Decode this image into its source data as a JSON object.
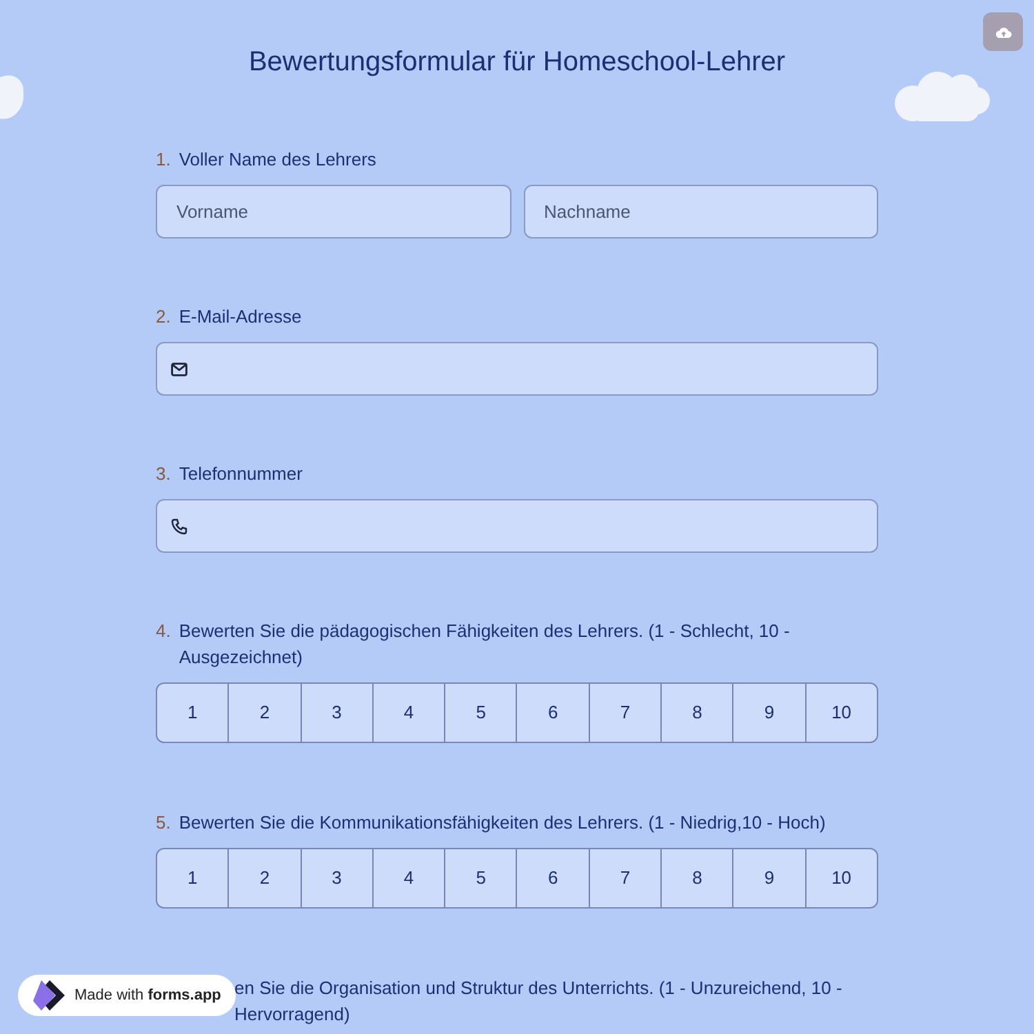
{
  "title": "Bewertungsformular für Homeschool-Lehrer",
  "questions": [
    {
      "kind": "name",
      "number": "1.",
      "label": "Voller Name des Lehrers",
      "fields": [
        {
          "placeholder": "Vorname"
        },
        {
          "placeholder": "Nachname"
        }
      ]
    },
    {
      "kind": "email",
      "number": "2.",
      "label": "E-Mail-Adresse"
    },
    {
      "kind": "phone",
      "number": "3.",
      "label": "Telefonnummer"
    },
    {
      "kind": "rating",
      "number": "4.",
      "label": "Bewerten Sie die pädagogischen Fähigkeiten des Lehrers. (1 - Schlecht, 10 - Ausgezeichnet)",
      "options": [
        "1",
        "2",
        "3",
        "4",
        "5",
        "6",
        "7",
        "8",
        "9",
        "10"
      ]
    },
    {
      "kind": "rating",
      "number": "5.",
      "label": "Bewerten Sie die Kommunikationsfähigkeiten des Lehrers. (1 - Niedrig,10 - Hoch)",
      "options": [
        "1",
        "2",
        "3",
        "4",
        "5",
        "6",
        "7",
        "8",
        "9",
        "10"
      ]
    },
    {
      "kind": "partial",
      "label": "en Sie die Organisation und Struktur des Unterrichts. (1 - Unzureichend, 10 - Hervorragend)"
    }
  ],
  "badge": "Made with **forms.app**"
}
